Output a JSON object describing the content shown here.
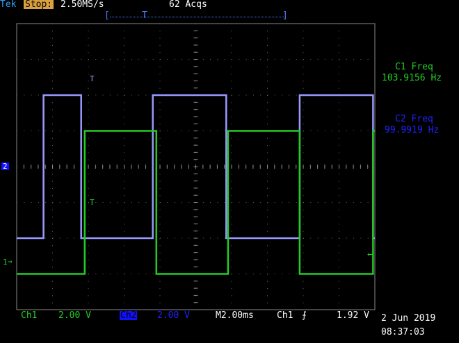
{
  "header": {
    "brand": "Tek",
    "run_state": "Stop:",
    "sample_rate": "2.50MS/s",
    "acqs": "62 Acqs",
    "trigger_bracket_left": "[",
    "trigger_bracket_right": "]",
    "trigger_marker": "T"
  },
  "measurements": {
    "c1_label": "C1 Freq",
    "c1_value": "103.9156 Hz",
    "c2_label": "C2 Freq",
    "c2_value": "99.9919 Hz"
  },
  "markers": {
    "ch2_ground": "2",
    "ch1_ground": "1",
    "ch2_trigger": "T",
    "ch1_trigger": "T",
    "trigger_level": "←"
  },
  "footer": {
    "ch1_label": "Ch1",
    "ch1_scale": "2.00 V",
    "ch2_label": "Ch2",
    "ch2_scale": "2.00 V",
    "timebase": "M2.00ms",
    "trigger_source": "Ch1",
    "trigger_slope": "⨍",
    "trigger_level": "1.92 V",
    "date": "2 Jun 2019",
    "time": "08:37:03"
  },
  "colors": {
    "ch1": "#22cc22",
    "ch2": "#9999ff",
    "grid": "#888888",
    "grid_dot": "#666666",
    "background": "#000000"
  },
  "chart_data": {
    "type": "line",
    "x_divisions": 10,
    "y_divisions": 8,
    "series": [
      {
        "name": "Ch2",
        "x": [
          0.0,
          0.75,
          0.75,
          1.8,
          1.8,
          3.8,
          3.8,
          5.85,
          5.85,
          7.9,
          7.9,
          9.95,
          9.95,
          10.0
        ],
        "y": [
          2,
          2,
          6,
          6,
          2,
          2,
          6,
          6,
          2,
          2,
          6,
          6,
          2,
          2
        ]
      },
      {
        "name": "Ch1",
        "x": [
          0.0,
          1.9,
          1.9,
          3.9,
          3.9,
          5.9,
          5.9,
          7.9,
          7.9,
          9.95,
          9.95,
          10.0
        ],
        "y": [
          1,
          1,
          5,
          5,
          1,
          1,
          5,
          5,
          1,
          1,
          5,
          5
        ]
      }
    ]
  }
}
